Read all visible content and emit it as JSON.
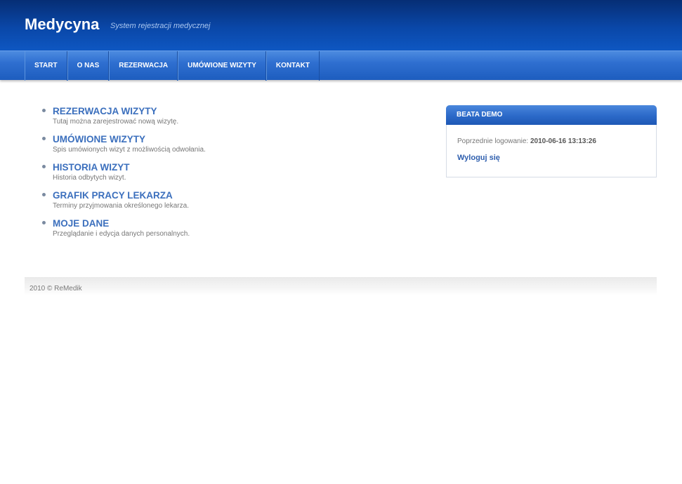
{
  "header": {
    "title": "Medycyna",
    "subtitle": "System rejestracji medycznej"
  },
  "nav": {
    "items": [
      {
        "label": "START"
      },
      {
        "label": "O NAS"
      },
      {
        "label": "REZERWACJA"
      },
      {
        "label": "UMÓWIONE WIZYTY"
      },
      {
        "label": "KONTAKT"
      }
    ]
  },
  "menu": {
    "items": [
      {
        "title": "REZERWACJA WIZYTY",
        "desc": "Tutaj można zarejestrować nową wizytę."
      },
      {
        "title": "UMÓWIONE WIZYTY",
        "desc": "Spis umówionych wizyt z możliwością odwołania."
      },
      {
        "title": "HISTORIA WIZYT",
        "desc": "Historia odbytych wizyt."
      },
      {
        "title": "GRAFIK PRACY LEKARZA",
        "desc": "Terminy przyjmowania określonego lekarza."
      },
      {
        "title": "MOJE DANE",
        "desc": "Przeglądanie i edycja danych personalnych."
      }
    ]
  },
  "user_box": {
    "name": "BEATA DEMO",
    "last_login_label": "Poprzednie logowanie:",
    "last_login_value": "2010-06-16 13:13:26",
    "logout_label": "Wyloguj się"
  },
  "footer": {
    "text": "2010 © ReMedik"
  },
  "colors": {
    "header_dark": "#062e75",
    "nav_blue": "#2f6fd0",
    "link_blue": "#3b6fbd"
  }
}
